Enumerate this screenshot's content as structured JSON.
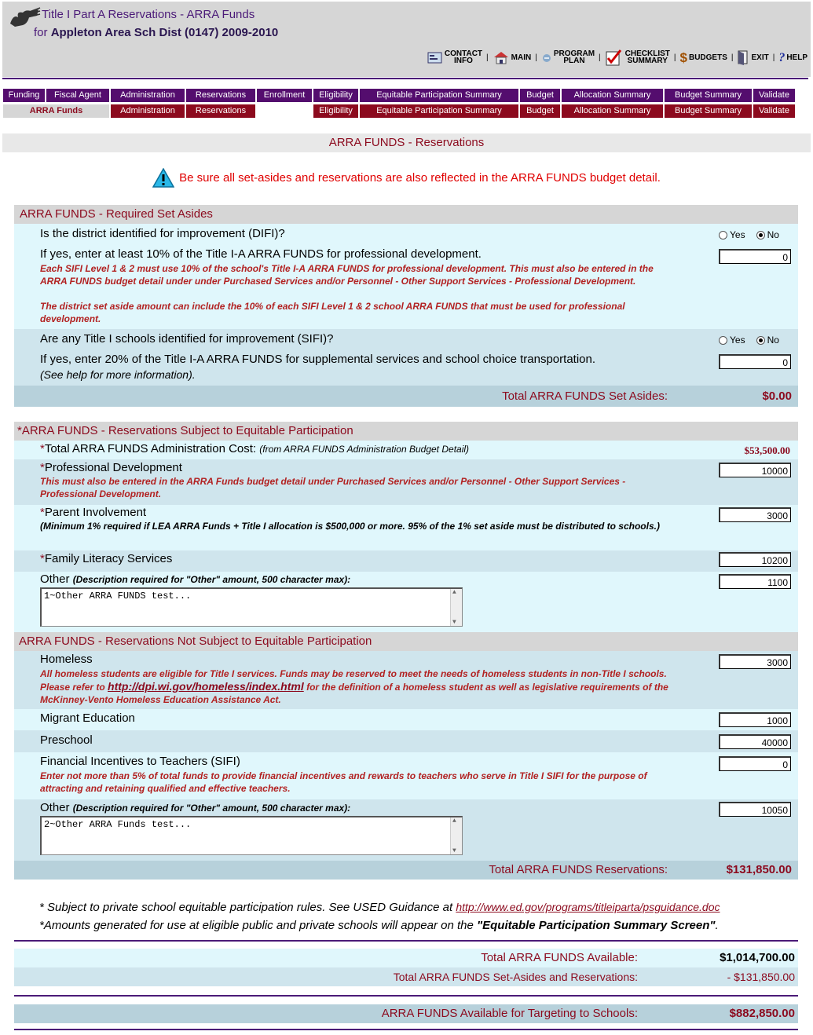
{
  "header": {
    "title": "Title I Part A Reservations - ARRA Funds",
    "subtitle_prefix": "for",
    "subtitle_district": "Appleton Area Sch Dist (0147)  2009-2010",
    "nav": [
      {
        "label1": "CONTACT",
        "label2": "INFO",
        "icon": "contact-info-icon"
      },
      {
        "label1": "MAIN",
        "label2": "",
        "icon": "house-icon"
      },
      {
        "label1": "PROGRAM",
        "label2": "PLAN",
        "icon": "program-plan-icon"
      },
      {
        "label1": "CHECKLIST",
        "label2": "SUMMARY",
        "icon": "checklist-icon"
      },
      {
        "label1": "BUDGETS",
        "label2": "",
        "icon": "dollar-icon"
      },
      {
        "label1": "EXIT",
        "label2": "",
        "icon": "exit-door-icon"
      },
      {
        "label1": "HELP",
        "label2": "",
        "icon": "help-icon"
      }
    ]
  },
  "tabs_row1": [
    "Funding",
    "Fiscal Agent",
    "Administration",
    "Reservations",
    "Enrollment",
    "Eligibility",
    "Equitable Participation Summary",
    "Budget",
    "Allocation Summary",
    "Budget Summary",
    "Validate"
  ],
  "tabs_row2": [
    "ARRA Funds",
    "Administration",
    "Reservations",
    "",
    "Eligibility",
    "Equitable Participation Summary",
    "Budget",
    "Allocation Summary",
    "Budget Summary",
    "Validate"
  ],
  "page_title": "ARRA FUNDS - Reservations",
  "warning": "Be sure all set-asides and reservations are also reflected in the ARRA FUNDS budget detail.",
  "set_asides": {
    "header": "ARRA FUNDS - Required Set Asides",
    "difi_q": "Is the district identified for improvement (DIFI)?",
    "yes": "Yes",
    "no": "No",
    "difi_pd_q": "If yes, enter at least 10% of the Title I-A ARRA FUNDS for professional development.",
    "difi_note1": "Each SIFI Level 1 & 2 must use 10% of the school's Title I-A ARRA FUNDS for professional development. This must also be entered in the ARRA FUNDS budget detail under under Purchased Services and/or Personnel - Other Support Services - Professional Development.",
    "difi_note2": "The district set aside amount can include the 10% of each SIFI Level 1 & 2 school ARRA FUNDS that must be used for professional development.",
    "difi_pd_value": "0",
    "sifi_q": "Are any Title I schools identified for improvement (SIFI)?",
    "sifi_ss_q": "If yes, enter 20% of the Title I-A ARRA FUNDS for supplemental services and school choice transportation.",
    "sifi_note": "(See help for more information).",
    "sifi_ss_value": "0",
    "total_label": "Total ARRA FUNDS Set Asides:",
    "total_value": "$0.00"
  },
  "equitable": {
    "header": "ARRA FUNDS - Reservations Subject to Equitable Participation",
    "admin_label": "Total ARRA FUNDS Administration Cost:",
    "admin_note": "(from ARRA FUNDS Administration Budget Detail)",
    "admin_value": "$53,500.00",
    "pd_label": "Professional Development",
    "pd_note": "This must also be entered in the ARRA Funds budget detail under Purchased Services and/or Personnel - Other Support Services - Professional Development.",
    "pd_value": "10000",
    "pi_label": "Parent Involvement",
    "pi_note": "(Minimum 1% required if LEA ARRA Funds + Title I allocation is $500,000 or more. 95% of the 1% set aside must be distributed to schools.)",
    "pi_value": "3000",
    "fl_label": "Family Literacy Services",
    "fl_value": "10200",
    "other_label": "Other",
    "other_note": "(Description required for \"Other\" amount, 500 character max):",
    "other_value": "1100",
    "other_text": "1~Other ARRA FUNDS test..."
  },
  "not_equitable": {
    "header": "ARRA FUNDS - Reservations Not Subject to Equitable Participation",
    "homeless_label": "Homeless",
    "homeless_note_a": "All homeless students are eligible for Title I services. Funds may be reserved to meet the needs of homeless students in non-Title I schools. Please refer to ",
    "homeless_link": "http://dpi.wi.gov/homeless/index.html",
    "homeless_note_b": " for the definition of a homeless student as well as legislative requirements of the McKinney-Vento Homeless Education Assistance Act.",
    "homeless_value": "3000",
    "migrant_label": "Migrant Education",
    "migrant_value": "1000",
    "preschool_label": "Preschool",
    "preschool_value": "40000",
    "fin_label": "Financial Incentives to Teachers (SIFI)",
    "fin_note": "Enter not more than 5% of total funds to provide financial incentives and rewards to teachers who serve in Title I SIFI for the purpose of attracting and retaining qualified and effective teachers.",
    "fin_value": "0",
    "other_label": "Other",
    "other_note": "(Description required for \"Other\" amount, 500 character max):",
    "other_value": "10050",
    "other_text": "2~Other ARRA Funds test...",
    "total_label": "Total ARRA FUNDS Reservations:",
    "total_value": "$131,850.00"
  },
  "footnotes": {
    "f1": "* Subject to private school equitable participation rules. See USED Guidance at ",
    "f1_link": "http://www.ed.gov/programs/titleiparta/psguidance.doc",
    "f2a": "*Amounts generated for use at eligible public and private schools will appear on the ",
    "f2b": "\"Equitable Participation Summary Screen\"",
    "f2c": "."
  },
  "summary": {
    "available_label": "Total ARRA FUNDS Available:",
    "available_value": "$1,014,700.00",
    "setaside_label": "Total ARRA FUNDS Set-Asides and Reservations:",
    "setaside_value": "- $131,850.00",
    "targeting_label": "ARRA FUNDS Available for Targeting to Schools:",
    "targeting_value": "$882,850.00"
  }
}
